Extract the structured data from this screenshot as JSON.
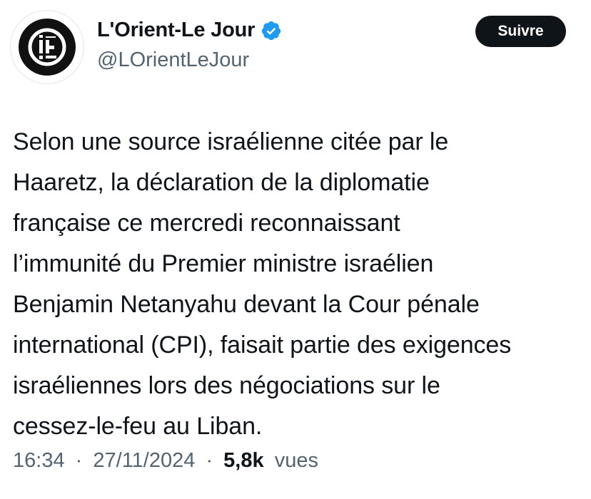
{
  "author": {
    "display_name": "L'Orient-Le Jour",
    "handle": "@LOrientLeJour",
    "verified": true,
    "avatar_icon": "lorient-le-jour-logo-icon",
    "verified_icon": "verified-badge-icon",
    "verified_color": "#1d9bf0"
  },
  "follow_button": {
    "label": "Suivre"
  },
  "tweet": {
    "lines": [
      "Selon une source israélienne citée par le",
      "Haaretz, la déclaration de la diplomatie",
      "française ce mercredi reconnaissant",
      "l’immunité du Premier ministre israélien",
      "Benjamin Netanyahu devant la Cour pénale",
      "international (CPI), faisait partie des exigences",
      "israéliennes lors des négociations sur le",
      "cessez-le-feu au Liban."
    ]
  },
  "meta": {
    "time": "16:34",
    "separator": "·",
    "date": "27/11/2024",
    "views_count": "5,8k",
    "views_label": "vues"
  }
}
